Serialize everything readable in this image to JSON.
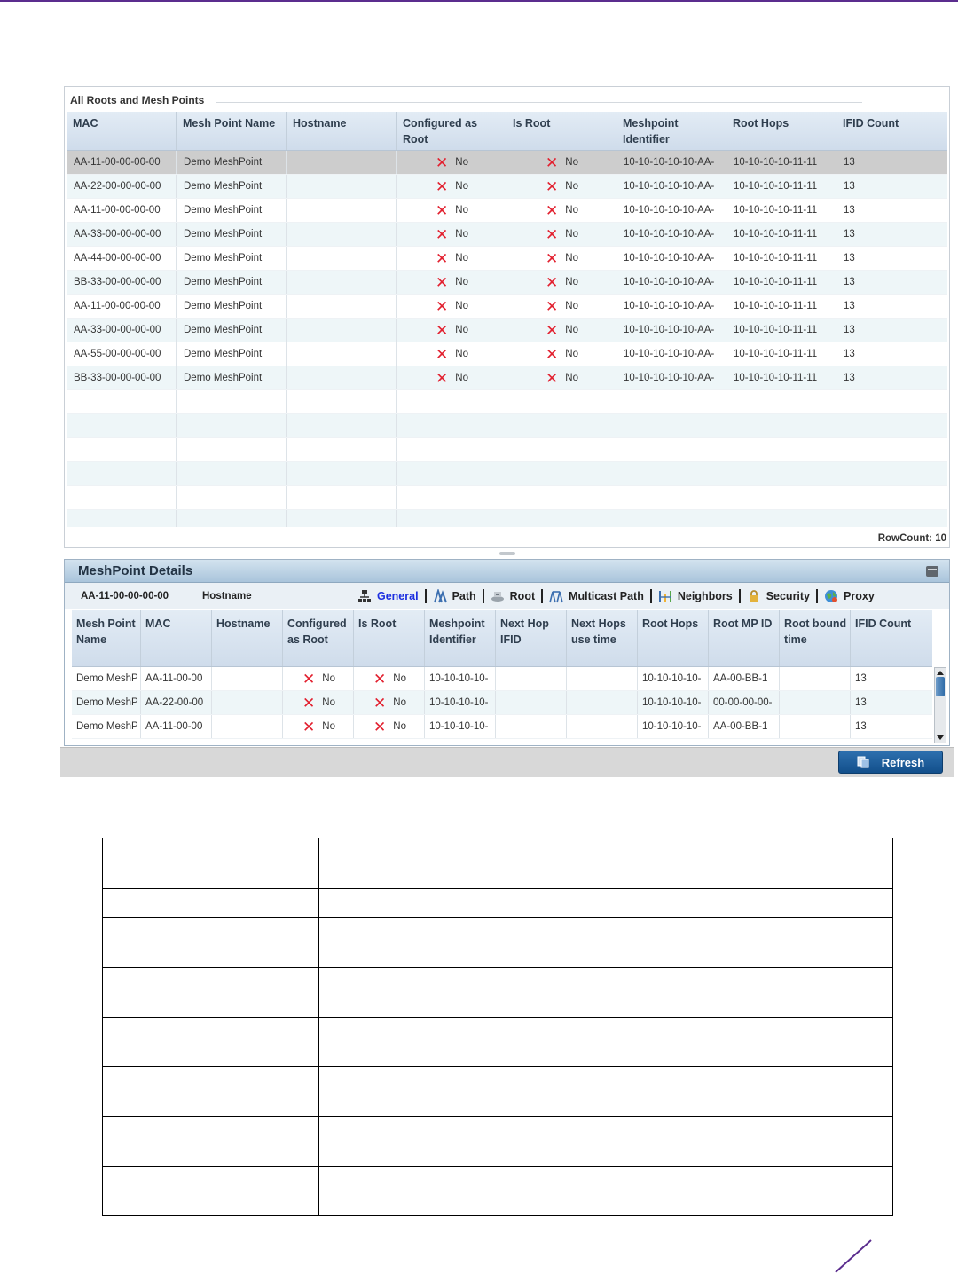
{
  "roots_panel": {
    "title": "All Roots and Mesh Points",
    "columns": [
      "MAC",
      "Mesh Point Name",
      "Hostname",
      "Configured as Root",
      "Is Root",
      "Meshpoint Identifier",
      "Root Hops",
      "IFID Count"
    ],
    "rows": [
      {
        "mac": "AA-11-00-00-00-00",
        "name": "Demo MeshPoint",
        "hostname": "",
        "configured": "No",
        "is_root": "No",
        "identifier": "10-10-10-10-10-AA-",
        "root_hops": "10-10-10-10-11-11",
        "ifid": "13"
      },
      {
        "mac": "AA-22-00-00-00-00",
        "name": "Demo MeshPoint",
        "hostname": "",
        "configured": "No",
        "is_root": "No",
        "identifier": "10-10-10-10-10-AA-",
        "root_hops": "10-10-10-10-11-11",
        "ifid": "13"
      },
      {
        "mac": "AA-11-00-00-00-00",
        "name": "Demo MeshPoint",
        "hostname": "",
        "configured": "No",
        "is_root": "No",
        "identifier": "10-10-10-10-10-AA-",
        "root_hops": "10-10-10-10-11-11",
        "ifid": "13"
      },
      {
        "mac": "AA-33-00-00-00-00",
        "name": "Demo MeshPoint",
        "hostname": "",
        "configured": "No",
        "is_root": "No",
        "identifier": "10-10-10-10-10-AA-",
        "root_hops": "10-10-10-10-11-11",
        "ifid": "13"
      },
      {
        "mac": "AA-44-00-00-00-00",
        "name": "Demo MeshPoint",
        "hostname": "",
        "configured": "No",
        "is_root": "No",
        "identifier": "10-10-10-10-10-AA-",
        "root_hops": "10-10-10-10-11-11",
        "ifid": "13"
      },
      {
        "mac": "BB-33-00-00-00-00",
        "name": "Demo MeshPoint",
        "hostname": "",
        "configured": "No",
        "is_root": "No",
        "identifier": "10-10-10-10-10-AA-",
        "root_hops": "10-10-10-10-11-11",
        "ifid": "13"
      },
      {
        "mac": "AA-11-00-00-00-00",
        "name": "Demo MeshPoint",
        "hostname": "",
        "configured": "No",
        "is_root": "No",
        "identifier": "10-10-10-10-10-AA-",
        "root_hops": "10-10-10-10-11-11",
        "ifid": "13"
      },
      {
        "mac": "AA-33-00-00-00-00",
        "name": "Demo MeshPoint",
        "hostname": "",
        "configured": "No",
        "is_root": "No",
        "identifier": "10-10-10-10-10-AA-",
        "root_hops": "10-10-10-10-11-11",
        "ifid": "13"
      },
      {
        "mac": "AA-55-00-00-00-00",
        "name": "Demo MeshPoint",
        "hostname": "",
        "configured": "No",
        "is_root": "No",
        "identifier": "10-10-10-10-10-AA-",
        "root_hops": "10-10-10-10-11-11",
        "ifid": "13"
      },
      {
        "mac": "BB-33-00-00-00-00",
        "name": "Demo MeshPoint",
        "hostname": "",
        "configured": "No",
        "is_root": "No",
        "identifier": "10-10-10-10-10-AA-",
        "root_hops": "10-10-10-10-11-11",
        "ifid": "13"
      }
    ],
    "selected_row": 0,
    "row_count_label": "RowCount: 10"
  },
  "details_panel": {
    "title": "MeshPoint Details",
    "selected_mac": "AA-11-00-00-00-00",
    "hostname_label": "Hostname",
    "tabs": [
      {
        "label": "General",
        "icon": "network-icon",
        "active": true
      },
      {
        "label": "Path",
        "icon": "path-icon",
        "active": false
      },
      {
        "label": "Root",
        "icon": "root-icon",
        "active": false
      },
      {
        "label": "Multicast Path",
        "icon": "multicast-icon",
        "active": false
      },
      {
        "label": "Neighbors",
        "icon": "neighbors-icon",
        "active": false
      },
      {
        "label": "Security",
        "icon": "lock-icon",
        "active": false
      },
      {
        "label": "Proxy",
        "icon": "globe-icon",
        "active": false
      }
    ],
    "columns": [
      "Mesh Point Name",
      "MAC",
      "Hostname",
      "Configured as Root",
      "Is Root",
      "Meshpoint Identifier",
      "Next Hop IFID",
      "Next Hops use time",
      "Root Hops",
      "Root MP ID",
      "Root bound time",
      "IFID Count"
    ],
    "rows": [
      {
        "name": "Demo MeshP",
        "mac": "AA-11-00-00",
        "hostname": "",
        "configured": "No",
        "is_root": "No",
        "identifier": "10-10-10-10-",
        "next_hop_ifid": "",
        "next_hops_use_time": "",
        "root_hops": "10-10-10-10-",
        "root_mp_id": "AA-00-BB-1",
        "root_bound_time": "",
        "ifid": "13"
      },
      {
        "name": "Demo MeshP",
        "mac": "AA-22-00-00",
        "hostname": "",
        "configured": "No",
        "is_root": "No",
        "identifier": "10-10-10-10-",
        "next_hop_ifid": "",
        "next_hops_use_time": "",
        "root_hops": "10-10-10-10-",
        "root_mp_id": "00-00-00-00-",
        "root_bound_time": "",
        "ifid": "13"
      },
      {
        "name": "Demo MeshP",
        "mac": "AA-11-00-00",
        "hostname": "",
        "configured": "No",
        "is_root": "No",
        "identifier": "10-10-10-10-",
        "next_hop_ifid": "",
        "next_hops_use_time": "",
        "root_hops": "10-10-10-10-",
        "root_mp_id": "AA-00-BB-1",
        "root_bound_time": "",
        "ifid": "13"
      }
    ]
  },
  "footer": {
    "refresh_label": "Refresh"
  },
  "colors": {
    "accent": "#5b2d8e",
    "negative_mark": "#e2202f",
    "active_tab": "#1b2ee0",
    "button": "#1f5f9e"
  }
}
